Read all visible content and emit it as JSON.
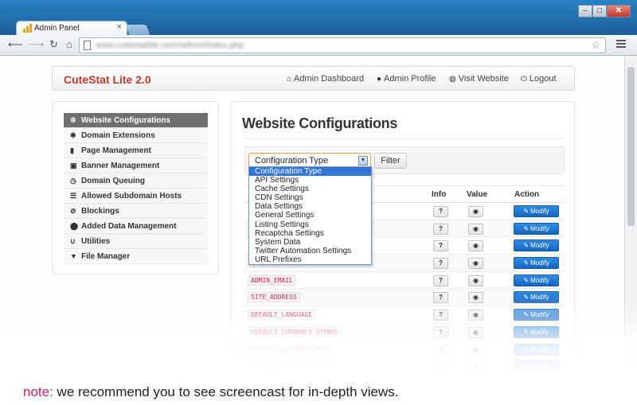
{
  "browser": {
    "tab_title": "Admin Panel",
    "tab_close": "×",
    "url": "www.cutestatlite.com/admin/index.php",
    "controls": {
      "minimize": "–",
      "maximize": "□",
      "close": "✕"
    },
    "nav_icons": [
      "back-arrow-icon",
      "forward-arrow-icon",
      "reload-icon",
      "home-icon"
    ]
  },
  "brand": "CuteStat Lite 2.0",
  "top_nav": [
    {
      "label": "Admin Dashboard",
      "icon": "home-icon"
    },
    {
      "label": "Admin Profile",
      "icon": "user-icon"
    },
    {
      "label": "Visit Website",
      "icon": "globe-icon"
    },
    {
      "label": "Logout",
      "icon": "power-icon"
    }
  ],
  "sidebar": {
    "items": [
      {
        "label": "Website Configurations",
        "icon": "gear-icon",
        "active": true
      },
      {
        "label": "Domain Extensions",
        "icon": "asterisk-icon"
      },
      {
        "label": "Page Management",
        "icon": "file-icon"
      },
      {
        "label": "Banner Management",
        "icon": "picture-icon"
      },
      {
        "label": "Domain Queuing",
        "icon": "clock-icon"
      },
      {
        "label": "Allowed Subdomain Hosts",
        "icon": "tasks-icon"
      },
      {
        "label": "Blockings",
        "icon": "ban-icon"
      },
      {
        "label": "Added Data Management",
        "icon": "map-marker-icon"
      },
      {
        "label": "Utilities",
        "icon": "magnet-icon"
      },
      {
        "label": "File Manager",
        "icon": "filter-icon"
      }
    ]
  },
  "main": {
    "title": "Website Configurations",
    "filter": {
      "select_value": "Configuration Type",
      "button_label": "Filter",
      "options": [
        "Configuration Type",
        "API Settings",
        "Cache Settings",
        "CDN Settings",
        "Data Settings",
        "General Settings",
        "Listing Settings",
        "Recaptcha Settings",
        "System Data",
        "Twitter Automation Settings",
        "URL Prefixes"
      ]
    },
    "table": {
      "columns": [
        "Info",
        "Value",
        "Action"
      ],
      "modify_label": "Modify",
      "rows": [
        {
          "key": ""
        },
        {
          "key": ""
        },
        {
          "key": ""
        },
        {
          "key": ""
        },
        {
          "key": "ADMIN_EMAIL"
        },
        {
          "key": "SITE_ADDRESS"
        },
        {
          "key": "DEFAULT_LANGUAGE"
        },
        {
          "key": "DEFAULT_CURRENCY_SYMBOL"
        },
        {
          "key": "DEFAULT_CURRENCY_RATE"
        },
        {
          "key": "TOTAL_INTERNET_USERS"
        }
      ]
    }
  },
  "note": {
    "label": "note:",
    "text": " we recommend you to see screencast for in-depth views."
  },
  "colors": {
    "brand": "#c0392b",
    "chrome": "#1f6fa8",
    "sidebar_active": "#707070",
    "modify_button": "#1e74d2",
    "dropdown_selected": "#3375d6",
    "note_label": "#c0235e"
  }
}
